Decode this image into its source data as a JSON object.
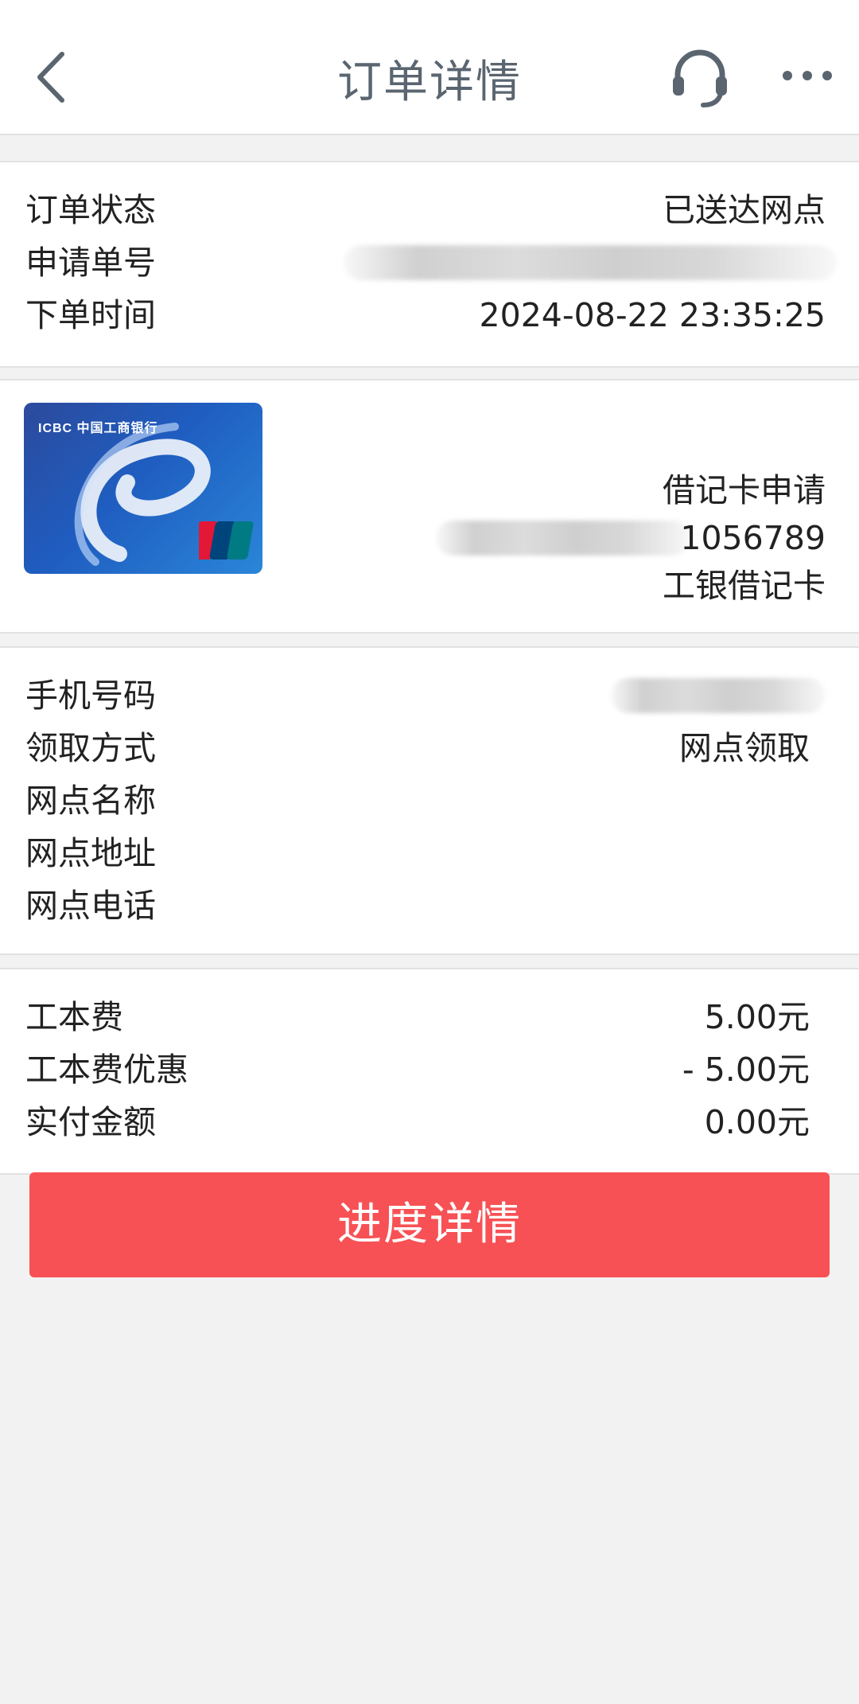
{
  "header": {
    "title": "订单详情",
    "icons": [
      "chevron-left-icon",
      "headset-icon",
      "more-icon"
    ]
  },
  "order": {
    "status_label": "订单状态",
    "status_value": "已送达网点",
    "number_label": "申请单号",
    "time_label": "下单时间",
    "time_value": "2024-08-22 23:35:25"
  },
  "card": {
    "bank_logo_text": "ICBC 中国工商银行",
    "apply_type": "借记卡申请",
    "card_number_tail": "1056789",
    "card_name": "工银借记卡"
  },
  "pickup": {
    "phone_label": "手机号码",
    "method_label": "领取方式",
    "method_value": "网点领取",
    "branch_name_label": "网点名称",
    "branch_address_label": "网点地址",
    "branch_phone_label": "网点电话"
  },
  "fees": {
    "cost_label": "工本费",
    "cost_value": "5.00元",
    "discount_label": "工本费优惠",
    "discount_value": "- 5.00元",
    "paid_label": "实付金额",
    "paid_value": "0.00元"
  },
  "actions": {
    "progress_button": "进度详情"
  },
  "colors": {
    "accent": "#f75155",
    "background": "#f2f2f2",
    "header_text": "#5a6570"
  }
}
